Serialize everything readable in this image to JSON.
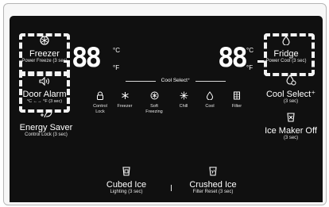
{
  "left": {
    "freezer": {
      "label": "Freezer",
      "sub": "Power Freeze (3 sec)"
    },
    "door_alarm": {
      "label": "Door Alarm",
      "sub": "°C ←→ °F (3 sec)"
    },
    "energy_saver": {
      "label": "Energy Saver",
      "sub": "Control Lock (3 sec)"
    },
    "temp": {
      "digits": "88",
      "unit_c": "°C",
      "unit_f": "°F"
    }
  },
  "right": {
    "fridge": {
      "label": "Fridge",
      "sub": "Power Cool (3 sec)"
    },
    "cool_select": {
      "label": "Cool Select⁺",
      "sub": "(3 sec)"
    },
    "ice_maker": {
      "label": "Ice Maker Off",
      "sub": "(3 sec)"
    },
    "temp": {
      "digits": "88",
      "unit_c": "°C",
      "unit_f": "°F"
    }
  },
  "cool_select_bar": {
    "title": "Cool Select⁺",
    "items": [
      {
        "label": "Control Lock",
        "icon": "lock-icon"
      },
      {
        "label": "Freezer",
        "icon": "freezer-snowflake-icon"
      },
      {
        "label": "Soft Freezing",
        "icon": "soft-freezing-icon"
      },
      {
        "label": "Chill",
        "icon": "chill-icon"
      },
      {
        "label": "Cool",
        "icon": "cool-drop-icon"
      },
      {
        "label": "Filter",
        "icon": "filter-icon"
      }
    ]
  },
  "bottom": {
    "cubed_ice": {
      "label": "Cubed Ice",
      "sub": "Lighting (3 sec)"
    },
    "crushed_ice": {
      "label": "Crushed Ice",
      "sub": "Filter Reset (3 sec)"
    }
  }
}
